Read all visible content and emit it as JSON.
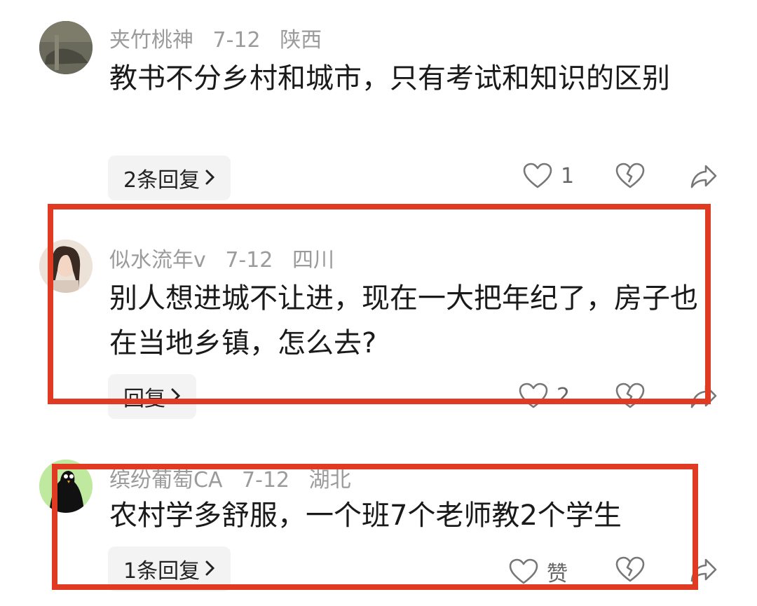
{
  "comments": [
    {
      "username": "夹竹桃神",
      "date": "7-12",
      "location": "陕西",
      "text": "教书不分乡村和城市，只有考试和知识的区别",
      "reply_label": "2条回复",
      "like_count": "1"
    },
    {
      "username": "似水流年v",
      "date": "7-12",
      "location": "四川",
      "text": "别人想进城不让进，现在一大把年纪了，房子也在当地乡镇，怎么去?",
      "reply_label": "回复",
      "like_count": "2"
    },
    {
      "username": "缤纷葡萄CA",
      "date": "7-12",
      "location": "湖北",
      "text": "农村学多舒服，一个班7个老师教2个学生",
      "reply_label": "1条回复",
      "like_count": "赞"
    }
  ],
  "icons": {
    "like": "heart-icon",
    "dislike": "broken-heart-icon",
    "share": "share-arrow-icon",
    "chevron": "chevron-right-icon"
  },
  "colors": {
    "highlight_box": "#e03a22",
    "meta_text": "#9b9b9b",
    "body_text": "#1a1a1a",
    "reply_bg": "#f3f3f3"
  }
}
